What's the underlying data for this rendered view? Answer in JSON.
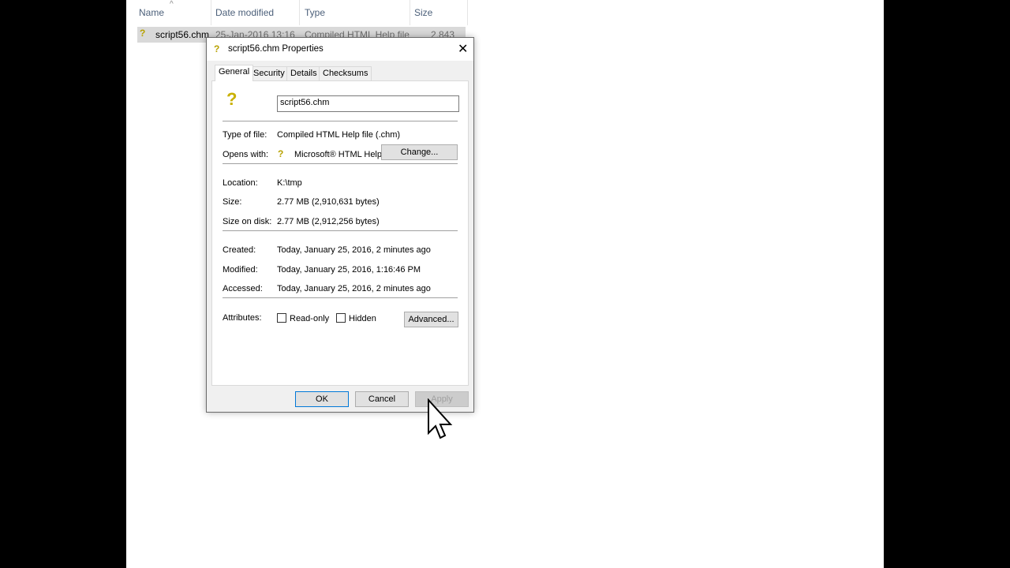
{
  "explorer": {
    "columns": [
      "Name",
      "Date modified",
      "Type",
      "Size"
    ],
    "file": {
      "name": "script56.chm",
      "date": "25-Jan-2016 13:16",
      "type": "Compiled HTML Help file",
      "size": "2,843 KB"
    }
  },
  "dialog": {
    "title": "script56.chm Properties",
    "tabs": [
      "General",
      "Security",
      "Details",
      "Checksums"
    ],
    "filename": "script56.chm",
    "type_label": "Type of file:",
    "type_value": "Compiled HTML Help file (.chm)",
    "opens_label": "Opens with:",
    "opens_value": "Microsoft® HTML Help",
    "change_label": "Change...",
    "location_label": "Location:",
    "location_value": "K:\\tmp",
    "size_label": "Size:",
    "size_value": "2.77 MB (2,910,631 bytes)",
    "disk_label": "Size on disk:",
    "disk_value": "2.77 MB (2,912,256 bytes)",
    "created_label": "Created:",
    "created_value": "Today, January 25, 2016, 2 minutes ago",
    "modified_label": "Modified:",
    "modified_value": "Today, January 25, 2016, 1:16:46 PM",
    "accessed_label": "Accessed:",
    "accessed_value": "Today, January 25, 2016, 2 minutes ago",
    "attributes_label": "Attributes:",
    "readonly_label": "Read-only",
    "hidden_label": "Hidden",
    "advanced_label": "Advanced...",
    "ok_label": "OK",
    "cancel_label": "Cancel",
    "apply_label": "Apply"
  }
}
